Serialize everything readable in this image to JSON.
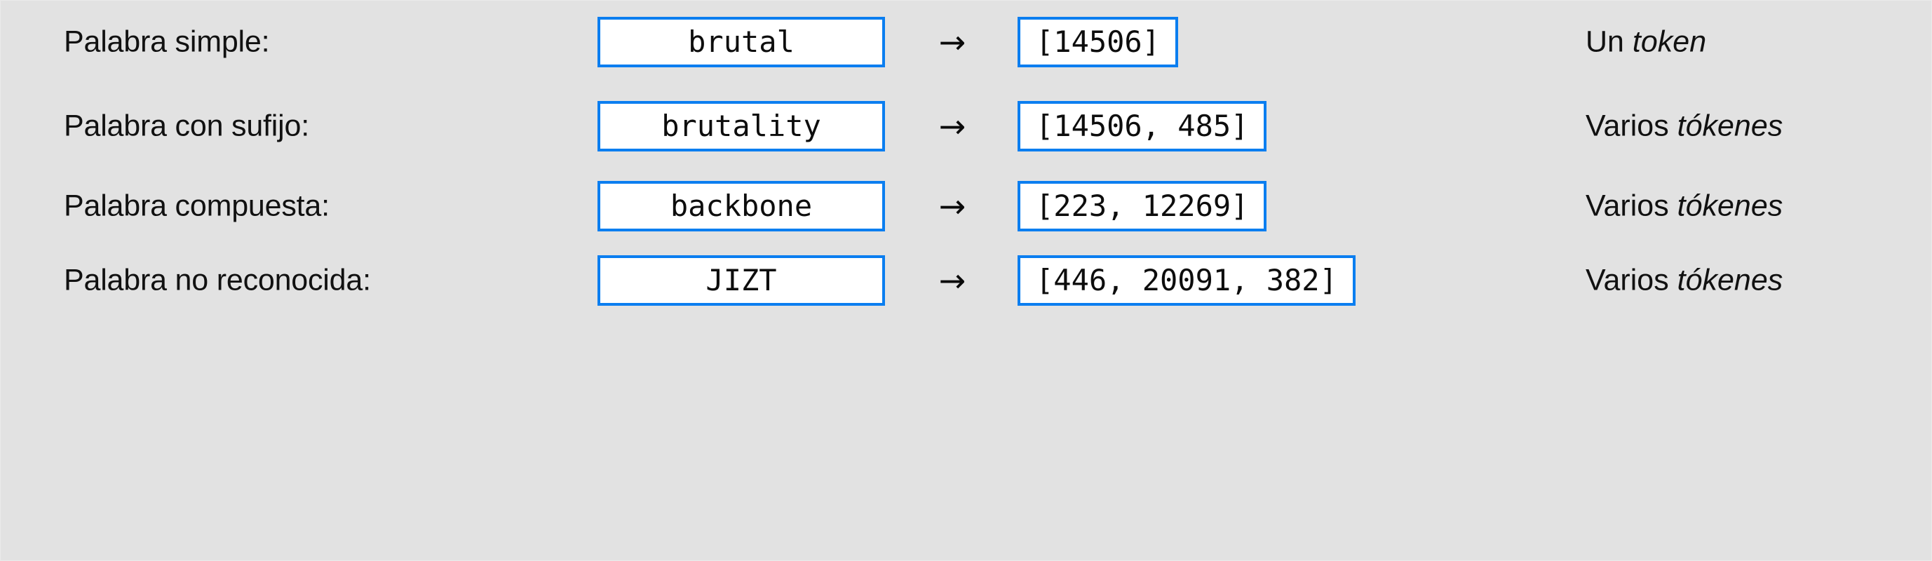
{
  "panel": {
    "background_color": "#e2e2e2",
    "accent_color": "#0b7ef0",
    "box_background": "#ffffff",
    "text_color": "#111111"
  },
  "arrow_glyph": "→",
  "rows": [
    {
      "label": "Palabra simple:",
      "word": "brutal",
      "arrow": "→",
      "tokens": "[14506]",
      "note_prefix": "Un ",
      "note_emphasis": "token"
    },
    {
      "label": "Palabra con sufijo:",
      "word": "brutality",
      "arrow": "→",
      "tokens": "[14506, 485]",
      "note_prefix": "Varios ",
      "note_emphasis": "tókenes"
    },
    {
      "label": "Palabra compuesta:",
      "word": "backbone",
      "arrow": "→",
      "tokens": "[223, 12269]",
      "note_prefix": "Varios ",
      "note_emphasis": "tókenes"
    },
    {
      "label": "Palabra no reconocida:",
      "word": "JIZT",
      "arrow": "→",
      "tokens": "[446, 20091, 382]",
      "note_prefix": "Varios ",
      "note_emphasis": "tókenes"
    }
  ]
}
